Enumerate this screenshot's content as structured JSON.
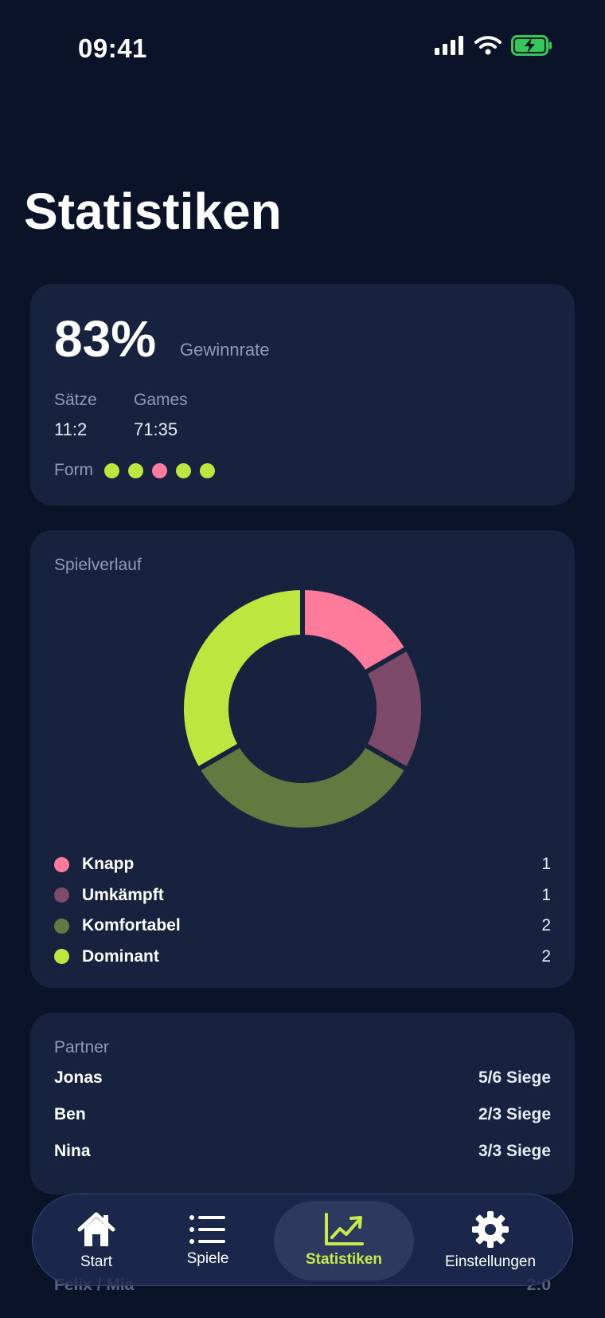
{
  "status_bar": {
    "time": "09:41"
  },
  "page": {
    "title": "Statistiken"
  },
  "summary": {
    "win_rate": "83%",
    "win_rate_label": "Gewinnrate",
    "sets_label": "Sätze",
    "sets_value": "11:2",
    "games_label": "Games",
    "games_value": "71:35",
    "form_label": "Form",
    "form": [
      "win",
      "win",
      "loss",
      "win",
      "win"
    ]
  },
  "colors": {
    "win": "#bde63f",
    "loss": "#ff7b9c",
    "accent": "#c8ea4a"
  },
  "chart_data": {
    "type": "pie",
    "title": "Spielverlauf",
    "categories": [
      "Knapp",
      "Umkämpft",
      "Komfortabel",
      "Dominant"
    ],
    "values": [
      1,
      1,
      2,
      2
    ],
    "colors": [
      "#ff7b9c",
      "#7d4a6a",
      "#617a40",
      "#bde63f"
    ],
    "legend_position": "bottom"
  },
  "partners": {
    "label": "Partner",
    "items": [
      {
        "name": "Jonas",
        "record": "5/6 Siege"
      },
      {
        "name": "Ben",
        "record": "2/3 Siege"
      },
      {
        "name": "Nina",
        "record": "3/3 Siege"
      }
    ],
    "partial_row": {
      "name": "Felix / Mia",
      "record": "2:0"
    }
  },
  "tabs": [
    {
      "label": "Start",
      "icon": "house-icon",
      "active": false
    },
    {
      "label": "Spiele",
      "icon": "list-icon",
      "active": false
    },
    {
      "label": "Statistiken",
      "icon": "chart-icon",
      "active": true
    },
    {
      "label": "Einstellungen",
      "icon": "gear-icon",
      "active": false
    }
  ]
}
